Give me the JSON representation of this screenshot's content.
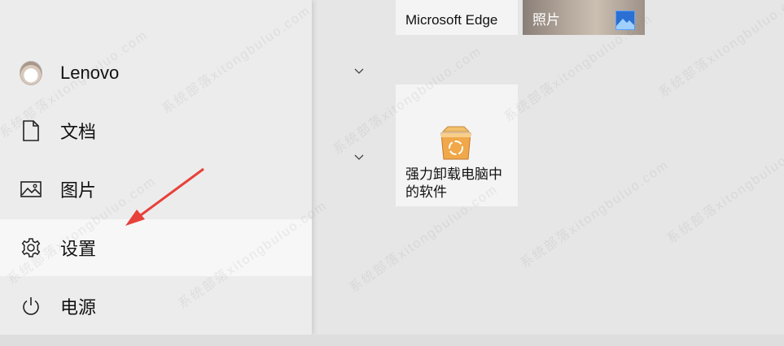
{
  "start_menu": {
    "items": [
      {
        "label": "Lenovo",
        "icon": "user-avatar"
      },
      {
        "label": "文档",
        "icon": "document-icon"
      },
      {
        "label": "图片",
        "icon": "picture-icon"
      },
      {
        "label": "设置",
        "icon": "gear-icon"
      },
      {
        "label": "电源",
        "icon": "power-icon"
      }
    ]
  },
  "tiles": {
    "edge_label": "Microsoft Edge",
    "photos_label": "照片",
    "uninstaller_label_line1": "强力卸载电脑中",
    "uninstaller_label_line2": "的软件"
  },
  "annotation": {
    "arrow_color": "#e8403a"
  },
  "watermark": "系统部落xitongbuluo.com"
}
